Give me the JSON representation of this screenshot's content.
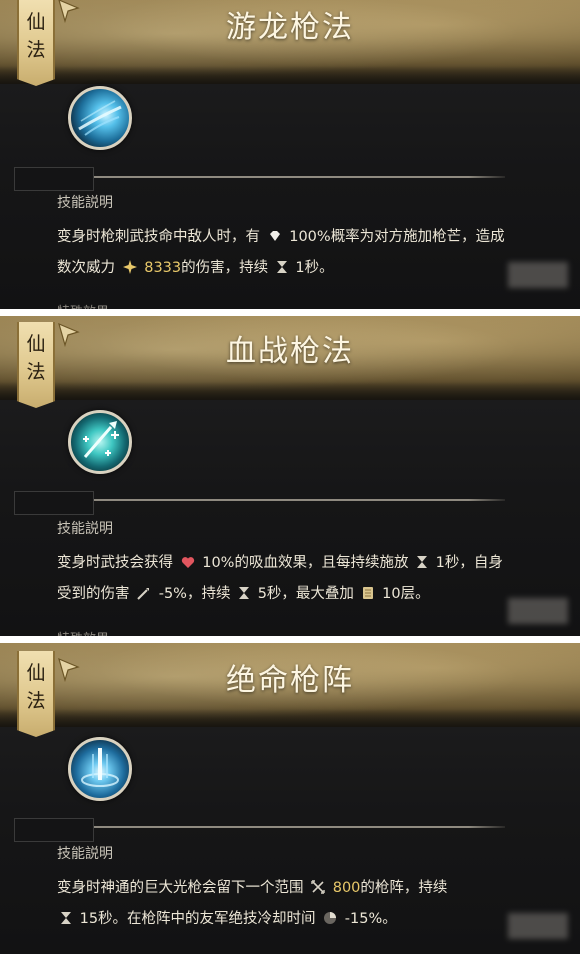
{
  "panels": [
    {
      "title": "游龙枪法",
      "tag": [
        "仙",
        "法"
      ],
      "section_label": "技能説明",
      "desc": {
        "l1a": "变身时枪刺武技命中敌人时，有",
        "l1b": "100%",
        "l1c": "概率为对方施加枪芒，造成",
        "l2a": "数次威力",
        "l2b": "8333",
        "l2c": "的伤害，持续",
        "l2d": "1秒。"
      },
      "cut_label": "特殊效果"
    },
    {
      "title": "血战枪法",
      "tag": [
        "仙",
        "法"
      ],
      "section_label": "技能説明",
      "desc": {
        "l1a": "变身时武技会获得",
        "l1b": "10%",
        "l1c": "的吸血效果，且每持续施放",
        "l1d": "1秒，自身",
        "l2a": "受到的伤害",
        "l2b": "-5%，持续",
        "l2c": "5秒，最大叠加",
        "l2d": "10层。"
      },
      "cut_label": "特殊效果"
    },
    {
      "title": "绝命枪阵",
      "tag": [
        "仙",
        "法"
      ],
      "section_label": "技能説明",
      "desc": {
        "l1a": "变身时神通的巨大光枪会留下一个范围",
        "l1b": "800",
        "l1c": "的枪阵，持续",
        "l2a": "15秒。在枪阵中的友军绝技冷却时间",
        "l2b": "-15%。"
      }
    }
  ],
  "colors": {
    "accent_gold": "#e8c86a",
    "header_gold": "#8a7448",
    "panel_bg": "#181819"
  },
  "icons": [
    "gem-icon",
    "power-icon",
    "hourglass-icon",
    "heart-icon",
    "sword-icon",
    "stack-icon",
    "range-icon",
    "cooldown-icon"
  ]
}
